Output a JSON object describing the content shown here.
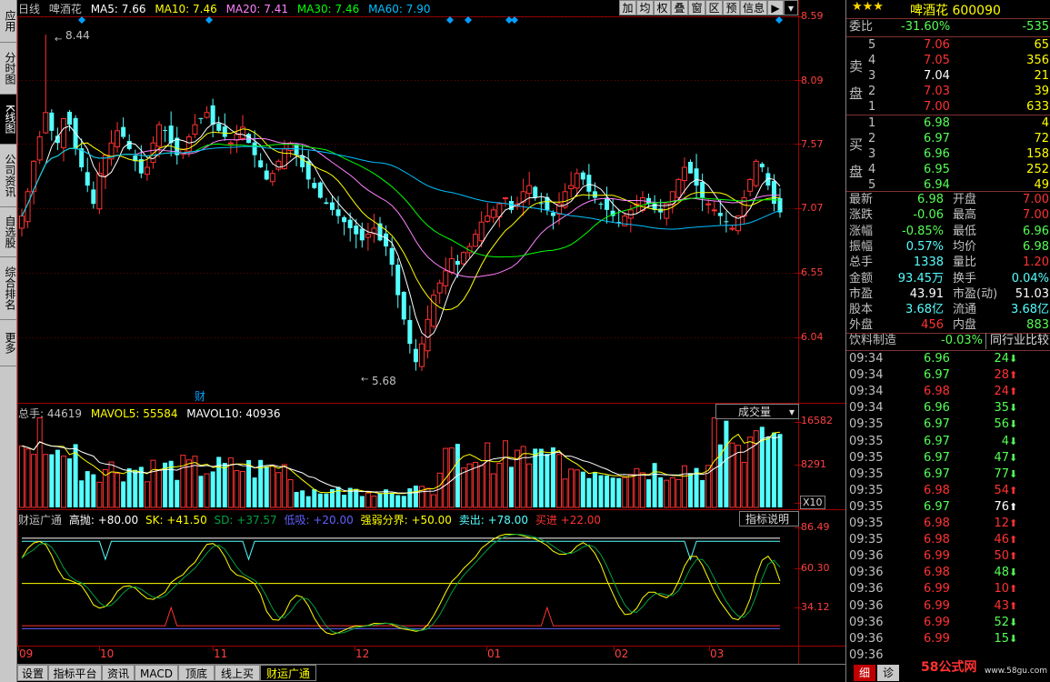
{
  "header": {
    "period": "日线",
    "stock_name": "啤酒花",
    "ma5_label": "MA5:",
    "ma5": "7.66",
    "ma10_label": "MA10:",
    "ma10": "7.46",
    "ma20_label": "MA20:",
    "ma20": "7.41",
    "ma30_label": "MA30:",
    "ma30": "7.46",
    "ma60_label": "MA60:",
    "ma60": "7.90"
  },
  "toolbar": [
    "加",
    "均",
    "权",
    "叠",
    "窗",
    "区",
    "预",
    "信息"
  ],
  "left_tabs": [
    {
      "label": "应用",
      "active": false
    },
    {
      "label": "分时图",
      "active": false
    },
    {
      "label": "K线图",
      "active": true
    },
    {
      "label": "公司资讯",
      "active": false
    },
    {
      "label": "自选股",
      "active": false
    },
    {
      "label": "综合排名",
      "active": false
    },
    {
      "label": "更多",
      "active": false
    }
  ],
  "price_axis": [
    "8.59",
    "8.09",
    "7.57",
    "7.07",
    "6.55",
    "6.04"
  ],
  "price_high_label": "8.44",
  "price_low_label": "5.68",
  "cai_marker": "财",
  "volume": {
    "label": "总手: 44619",
    "mavol5": "MAVOL5: 55584",
    "mavol10": "MAVOL10: 40936",
    "selector": "成交量",
    "axis": [
      "16582",
      "8291"
    ],
    "unit": "X10"
  },
  "indicator": {
    "name": "财运广通",
    "gaopao": "高抛: +80.00",
    "sk": "SK: +41.50",
    "sd": "SD: +37.57",
    "dixi": "低吸: +20.00",
    "qrfj": "强弱分界: +50.00",
    "maichu": "卖出: +78.00",
    "mairu": "买进 +22.00",
    "help": "指标说明",
    "axis": [
      "86.49",
      "60.30",
      "34.12"
    ]
  },
  "x_axis": [
    "09",
    "10",
    "11",
    "12",
    "01",
    "02",
    "03"
  ],
  "bottom_tabs": [
    {
      "label": "设置",
      "active": false
    },
    {
      "label": "指标平台",
      "active": false
    },
    {
      "label": "资讯",
      "active": false
    },
    {
      "label": "MACD",
      "active": false
    },
    {
      "label": "顶底",
      "active": false
    },
    {
      "label": "线上买",
      "active": false
    },
    {
      "label": "财运广通",
      "active": true
    }
  ],
  "quote": {
    "title": "啤酒花 600090",
    "weibi_label": "委比",
    "weibi": "-31.60%",
    "weicha": "-535",
    "sell_label": [
      "卖",
      "盘"
    ],
    "buy_label": [
      "买",
      "盘"
    ],
    "sells": [
      {
        "lvl": "5",
        "price": "7.06",
        "vol": "65"
      },
      {
        "lvl": "4",
        "price": "7.05",
        "vol": "356"
      },
      {
        "lvl": "3",
        "price": "7.04",
        "vol": "21"
      },
      {
        "lvl": "2",
        "price": "7.03",
        "vol": "39"
      },
      {
        "lvl": "1",
        "price": "7.00",
        "vol": "633"
      }
    ],
    "buys": [
      {
        "lvl": "1",
        "price": "6.98",
        "vol": "4"
      },
      {
        "lvl": "2",
        "price": "6.97",
        "vol": "72"
      },
      {
        "lvl": "3",
        "price": "6.96",
        "vol": "158"
      },
      {
        "lvl": "4",
        "price": "6.95",
        "vol": "252"
      },
      {
        "lvl": "5",
        "price": "6.94",
        "vol": "49"
      }
    ],
    "stats": [
      {
        "l1": "最新",
        "v1": "6.98",
        "l2": "开盘",
        "v2": "7.00"
      },
      {
        "l1": "涨跌",
        "v1": "-0.06",
        "l2": "最高",
        "v2": "7.00"
      },
      {
        "l1": "涨幅",
        "v1": "-0.85%",
        "l2": "最低",
        "v2": "6.96"
      },
      {
        "l1": "振幅",
        "v1": "0.57%",
        "l2": "均价",
        "v2": "6.98"
      },
      {
        "l1": "总手",
        "v1": "1338",
        "l2": "量比",
        "v2": "1.20"
      },
      {
        "l1": "金额",
        "v1": "93.45万",
        "l2": "换手",
        "v2": "0.04%"
      },
      {
        "l1": "市盈",
        "v1": "43.91",
        "l2": "市盈(动)",
        "v2": "51.03"
      },
      {
        "l1": "股本",
        "v1": "3.68亿",
        "l2": "流通",
        "v2": "3.68亿"
      },
      {
        "l1": "外盘",
        "v1": "456",
        "l2": "内盘",
        "v2": "883"
      }
    ],
    "industry": "饮料制造",
    "industry_chg": "-0.03%",
    "compare_btn": "同行业比较",
    "ticks": [
      {
        "t": "09:34",
        "p": "6.96",
        "v": "24",
        "d": "down"
      },
      {
        "t": "09:34",
        "p": "6.97",
        "v": "28",
        "d": "up"
      },
      {
        "t": "09:34",
        "p": "6.98",
        "v": "24",
        "d": "up"
      },
      {
        "t": "09:34",
        "p": "6.96",
        "v": "35",
        "d": "down"
      },
      {
        "t": "09:35",
        "p": "6.97",
        "v": "56",
        "d": "down"
      },
      {
        "t": "09:35",
        "p": "6.97",
        "v": "4",
        "d": "down"
      },
      {
        "t": "09:35",
        "p": "6.97",
        "v": "47",
        "d": "down"
      },
      {
        "t": "09:35",
        "p": "6.97",
        "v": "77",
        "d": "down"
      },
      {
        "t": "09:35",
        "p": "6.98",
        "v": "54",
        "d": "up"
      },
      {
        "t": "09:35",
        "p": "6.97",
        "v": "76",
        "d": "white"
      },
      {
        "t": "09:35",
        "p": "6.98",
        "v": "12",
        "d": "up"
      },
      {
        "t": "09:35",
        "p": "6.98",
        "v": "46",
        "d": "up"
      },
      {
        "t": "09:36",
        "p": "6.99",
        "v": "50",
        "d": "up"
      },
      {
        "t": "09:36",
        "p": "6.98",
        "v": "48",
        "d": "down"
      },
      {
        "t": "09:36",
        "p": "6.99",
        "v": "10",
        "d": "up"
      },
      {
        "t": "09:36",
        "p": "6.99",
        "v": "43",
        "d": "up"
      },
      {
        "t": "09:36",
        "p": "6.99",
        "v": "52",
        "d": "down"
      },
      {
        "t": "09:36",
        "p": "6.99",
        "v": "15",
        "d": "down"
      },
      {
        "t": "09:36",
        "p": "",
        "v": "",
        "d": ""
      }
    ],
    "bottom_tabs": [
      "细",
      "诊"
    ],
    "watermark": "58公式网",
    "watermark_url": "www.58gu.com"
  },
  "colors": {
    "up": "#ff3232",
    "down": "#54ffff",
    "ma5": "#ffffff",
    "ma10": "#ffff00",
    "ma20": "#ff80ff",
    "ma30": "#00ff00",
    "ma60": "#00c0ff"
  }
}
